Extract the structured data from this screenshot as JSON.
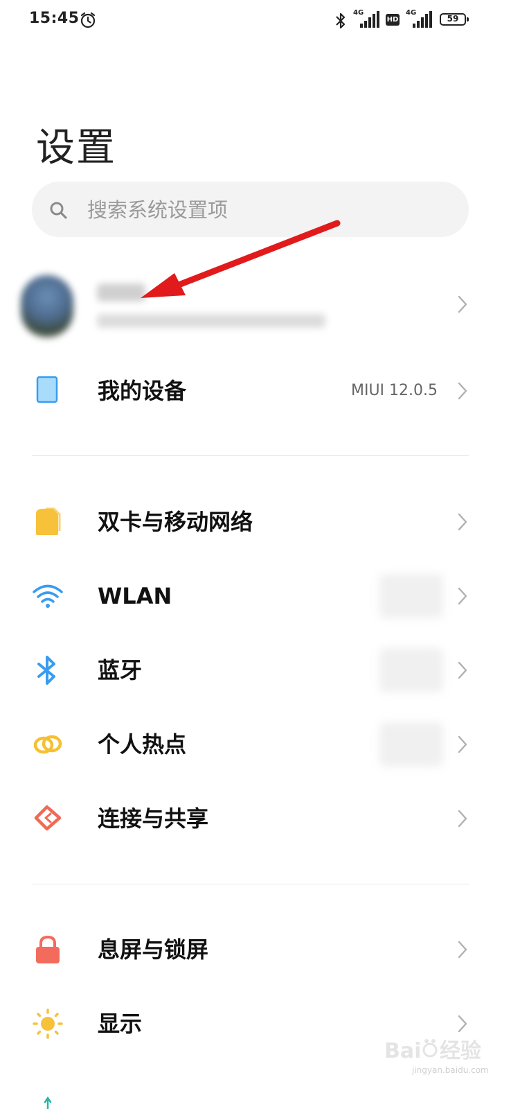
{
  "status_bar": {
    "time": "15:45",
    "network1": "4G",
    "hd": "HD",
    "network2": "4G",
    "battery": "59"
  },
  "page_title": "设置",
  "search": {
    "placeholder": "搜索系统设置项"
  },
  "my_device": {
    "label": "我的设备",
    "value": "MIUI 12.0.5"
  },
  "section_network": {
    "items": [
      {
        "label": "双卡与移动网络",
        "icon": "sim-card-icon",
        "color": "#f7c23a"
      },
      {
        "label": "WLAN",
        "icon": "wifi-icon",
        "color": "#3a9cf0"
      },
      {
        "label": "蓝牙",
        "icon": "bluetooth-icon",
        "color": "#3a9cf0"
      },
      {
        "label": "个人热点",
        "icon": "hotspot-icon",
        "color": "#f5c132"
      },
      {
        "label": "连接与共享",
        "icon": "connection-share-icon",
        "color": "#f06a55"
      }
    ]
  },
  "section_display": {
    "items": [
      {
        "label": "息屏与锁屏",
        "icon": "lock-icon",
        "color": "#f36b5c"
      },
      {
        "label": "显示",
        "icon": "brightness-icon",
        "color": "#f7c23a"
      }
    ]
  },
  "watermark": {
    "brand": "Bai",
    "brand_cn": "经验",
    "site": "jingyan.baidu.com"
  },
  "colors": {
    "accent_arrow": "#e11b1b",
    "chevron": "#b0b0b0",
    "divider": "#e6e6e6"
  }
}
